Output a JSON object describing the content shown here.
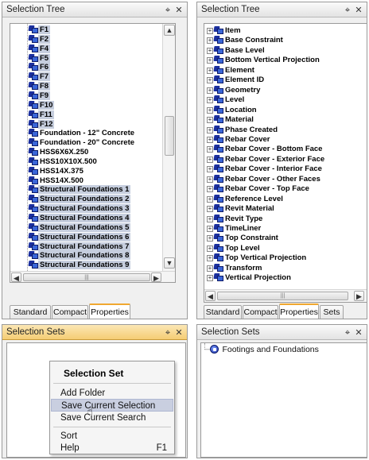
{
  "panels": {
    "top_left": {
      "title": "Selection Tree",
      "pin_icon": "pin-icon",
      "close_icon": "close-icon",
      "items": [
        {
          "label": "F1",
          "selected": true
        },
        {
          "label": "F2",
          "selected": true
        },
        {
          "label": "F4",
          "selected": true
        },
        {
          "label": "F5",
          "selected": true
        },
        {
          "label": "F6",
          "selected": true
        },
        {
          "label": "F7",
          "selected": true
        },
        {
          "label": "F8",
          "selected": true
        },
        {
          "label": "F9",
          "selected": true
        },
        {
          "label": "F10",
          "selected": true
        },
        {
          "label": "F11",
          "selected": true
        },
        {
          "label": "F12",
          "selected": true
        },
        {
          "label": "Foundation - 12\" Concrete",
          "selected": false
        },
        {
          "label": "Foundation - 20\" Concrete",
          "selected": false
        },
        {
          "label": "HSS6X6X.250",
          "selected": false
        },
        {
          "label": "HSS10X10X.500",
          "selected": false
        },
        {
          "label": "HSS14X.375",
          "selected": false
        },
        {
          "label": "HSS14X.500",
          "selected": false
        },
        {
          "label": "Structural Foundations 1",
          "selected": true
        },
        {
          "label": "Structural Foundations 2",
          "selected": true
        },
        {
          "label": "Structural Foundations 3",
          "selected": true
        },
        {
          "label": "Structural Foundations 4",
          "selected": true
        },
        {
          "label": "Structural Foundations 5",
          "selected": true
        },
        {
          "label": "Structural Foundations 6",
          "selected": true
        },
        {
          "label": "Structural Foundations 7",
          "selected": true
        },
        {
          "label": "Structural Foundations 8",
          "selected": true
        },
        {
          "label": "Structural Foundations 9",
          "selected": true
        }
      ],
      "tabs": [
        {
          "label": "Standard",
          "active": false
        },
        {
          "label": "Compact",
          "active": false
        },
        {
          "label": "Properties",
          "active": true
        }
      ]
    },
    "top_right": {
      "title": "Selection Tree",
      "pin_icon": "pin-icon",
      "close_icon": "close-icon",
      "items": [
        "Item",
        "Base Constraint",
        "Base Level",
        "Bottom Vertical Projection",
        "Element",
        "Element ID",
        "Geometry",
        "Level",
        "Location",
        "Material",
        "Phase Created",
        "Rebar Cover",
        "Rebar Cover - Bottom Face",
        "Rebar Cover - Exterior Face",
        "Rebar Cover - Interior Face",
        "Rebar Cover - Other Faces",
        "Rebar Cover - Top Face",
        "Reference Level",
        "Revit Material",
        "Revit Type",
        "TimeLiner",
        "Top Constraint",
        "Top Level",
        "Top Vertical Projection",
        "Transform",
        "Vertical Projection"
      ],
      "tabs": [
        {
          "label": "Standard",
          "active": false
        },
        {
          "label": "Compact",
          "active": false
        },
        {
          "label": "Properties",
          "active": true
        },
        {
          "label": "Sets",
          "active": false
        }
      ]
    },
    "bottom_left": {
      "title": "Selection Sets",
      "pin_icon": "pin-icon",
      "close_icon": "close-icon",
      "context_menu": {
        "title": "Selection Set",
        "items": [
          {
            "label": "Add Folder",
            "highlighted": false,
            "shortcut": ""
          },
          {
            "label": "Save Current Selection",
            "highlighted": true,
            "shortcut": ""
          },
          {
            "label": "Save Current Search",
            "highlighted": false,
            "shortcut": ""
          },
          {
            "label": "Sort",
            "highlighted": false,
            "shortcut": ""
          },
          {
            "label": "Help",
            "highlighted": false,
            "shortcut": "F1"
          }
        ]
      }
    },
    "bottom_right": {
      "title": "Selection Sets",
      "pin_icon": "pin-icon",
      "close_icon": "close-icon",
      "sets": [
        {
          "label": "Footings and Foundations",
          "icon": "selection-set-icon"
        }
      ]
    }
  },
  "colors": {
    "selection_bg": "#c6cede",
    "active_title": "#f5cd74",
    "menu_highlight": "#c9cfe0"
  }
}
